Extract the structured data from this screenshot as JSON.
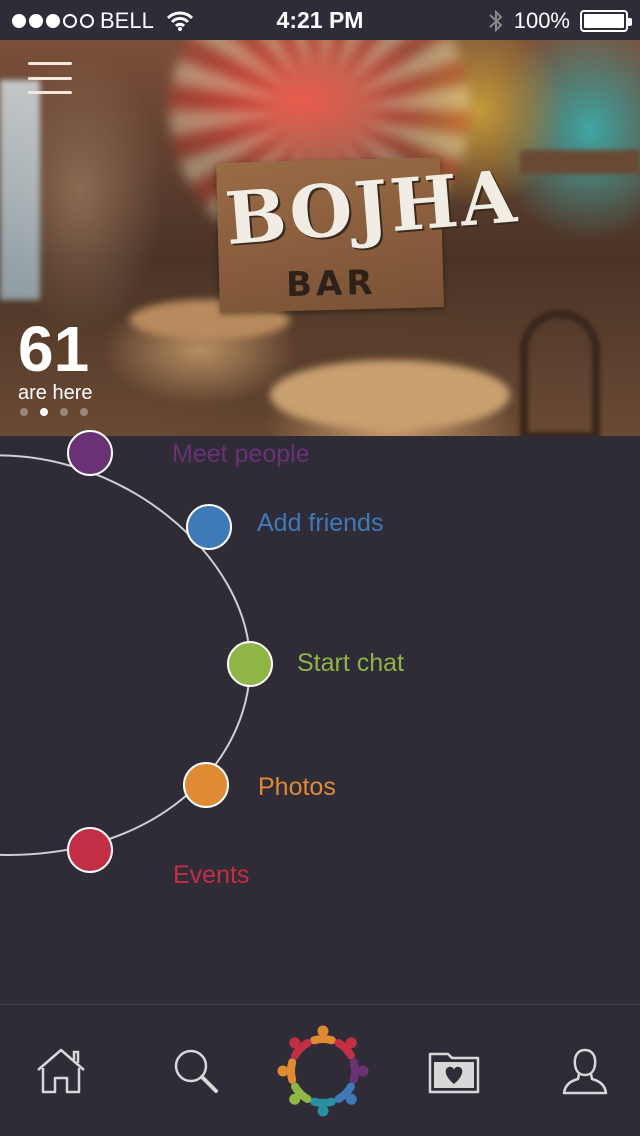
{
  "status_bar": {
    "carrier": "BELL",
    "time": "4:21 PM",
    "battery_percent": "100%",
    "signal_strength": 3,
    "signal_max": 5
  },
  "hero": {
    "venue_logo_main": "BOJHA",
    "venue_logo_sub": "BAR",
    "people_count": "61",
    "people_label": "are here",
    "carousel_index": 1,
    "carousel_total": 4
  },
  "menu": {
    "items": [
      {
        "label": "Meet people",
        "color": "#6a3175"
      },
      {
        "label": "Add friends",
        "color": "#3e7ab8"
      },
      {
        "label": "Start chat",
        "color": "#8fb546"
      },
      {
        "label": "Photos",
        "color": "#de8b34"
      },
      {
        "label": "Events",
        "color": "#c22f44"
      }
    ]
  },
  "tab_bar": {
    "tabs": [
      {
        "icon": "home-icon"
      },
      {
        "icon": "search-icon"
      },
      {
        "icon": "people-circle-icon"
      },
      {
        "icon": "favorites-folder-icon"
      },
      {
        "icon": "profile-icon"
      }
    ]
  },
  "colors": {
    "background": "#2f2c38",
    "icon_stroke": "#d8d8d8"
  }
}
